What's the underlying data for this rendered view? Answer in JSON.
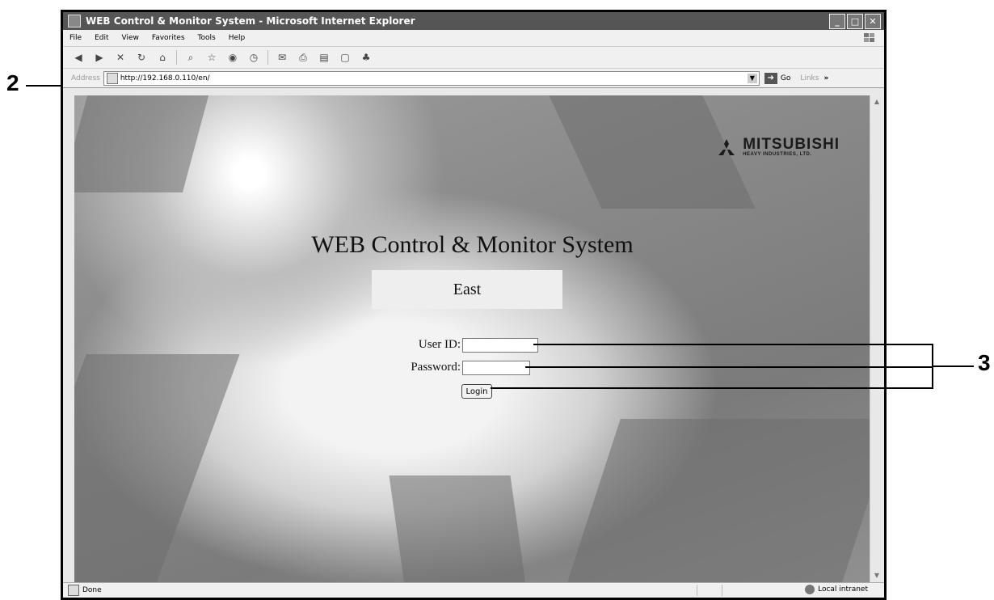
{
  "callouts": {
    "left": "2",
    "right": "3"
  },
  "window": {
    "title": "WEB Control & Monitor System - Microsoft Internet Explorer",
    "controls": [
      "minimize-icon",
      "maximize-icon",
      "close-icon"
    ]
  },
  "menubar": {
    "items": [
      "File",
      "Edit",
      "View",
      "Favorites",
      "Tools",
      "Help"
    ]
  },
  "toolbar": {
    "icons": [
      "back-icon",
      "forward-icon",
      "stop-icon",
      "refresh-icon",
      "home-icon",
      "search-icon",
      "favorites-icon",
      "media-icon",
      "history-icon",
      "mail-icon",
      "print-icon",
      "edit-icon",
      "discuss-icon",
      "messenger-icon"
    ]
  },
  "addressbar": {
    "label": "Address",
    "url": "http://192.168.0.110/en/",
    "go": "Go",
    "links": "Links",
    "chevron": "»"
  },
  "page": {
    "logo": {
      "name": "MITSUBISHI",
      "sub": "HEAVY INDUSTRIES, LTD."
    },
    "title": "WEB Control & Monitor System",
    "site_name": "East",
    "user_id_label": "User ID:",
    "user_id_value": "",
    "password_label": "Password:",
    "password_value": "",
    "login_label": "Login"
  },
  "statusbar": {
    "text": "Done",
    "zone": "Local intranet"
  }
}
